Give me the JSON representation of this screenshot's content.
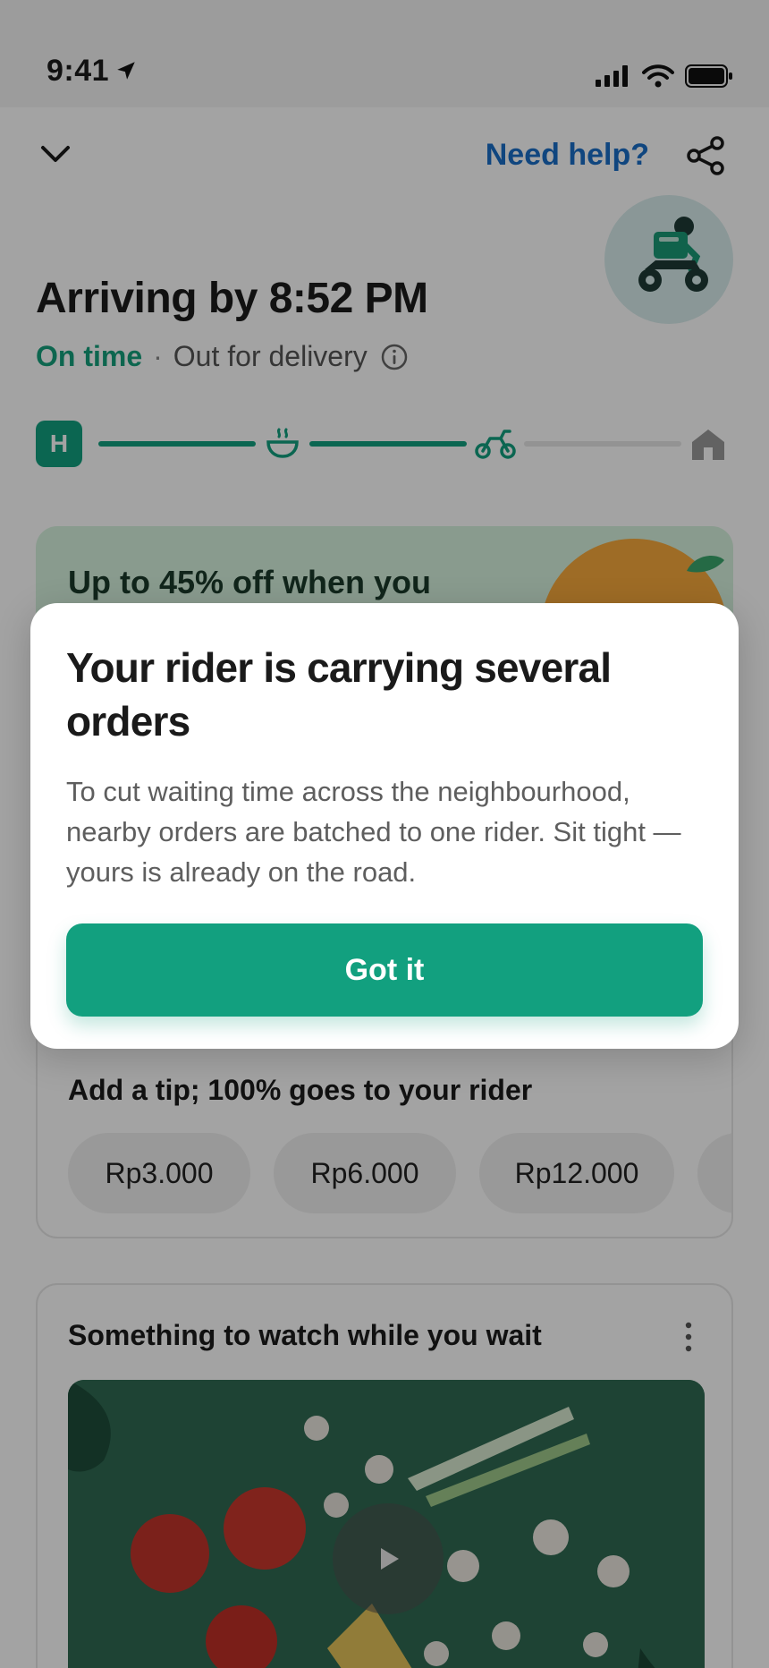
{
  "status_bar": {
    "time": "9:41"
  },
  "header": {
    "help_label": "Need help?",
    "arriving_title": "Arriving by 8:52 PM",
    "on_time": "On time",
    "separator": "·",
    "delivery_status": "Out for delivery"
  },
  "progress": {
    "start_badge": "H",
    "steps": [
      "store",
      "food-prep",
      "rider",
      "home"
    ],
    "current_step": "rider"
  },
  "promo": {
    "text": "Up to 45% off when you"
  },
  "modal": {
    "title": "Your rider is carrying several orders",
    "body": "To cut waiting time across the neighbourhood, nearby orders are batched to one rider. Sit tight — yours is already on the road.",
    "button": "Got it"
  },
  "tip": {
    "title": "Add a tip; 100% goes to your rider",
    "options": [
      "Rp3.000",
      "Rp6.000",
      "Rp12.000"
    ]
  },
  "watch": {
    "title": "Something to watch while you wait"
  },
  "colors": {
    "brand_green": "#12a07f",
    "link_blue": "#1a6ec7",
    "scrim": "rgba(0,0,0,0.36)"
  }
}
